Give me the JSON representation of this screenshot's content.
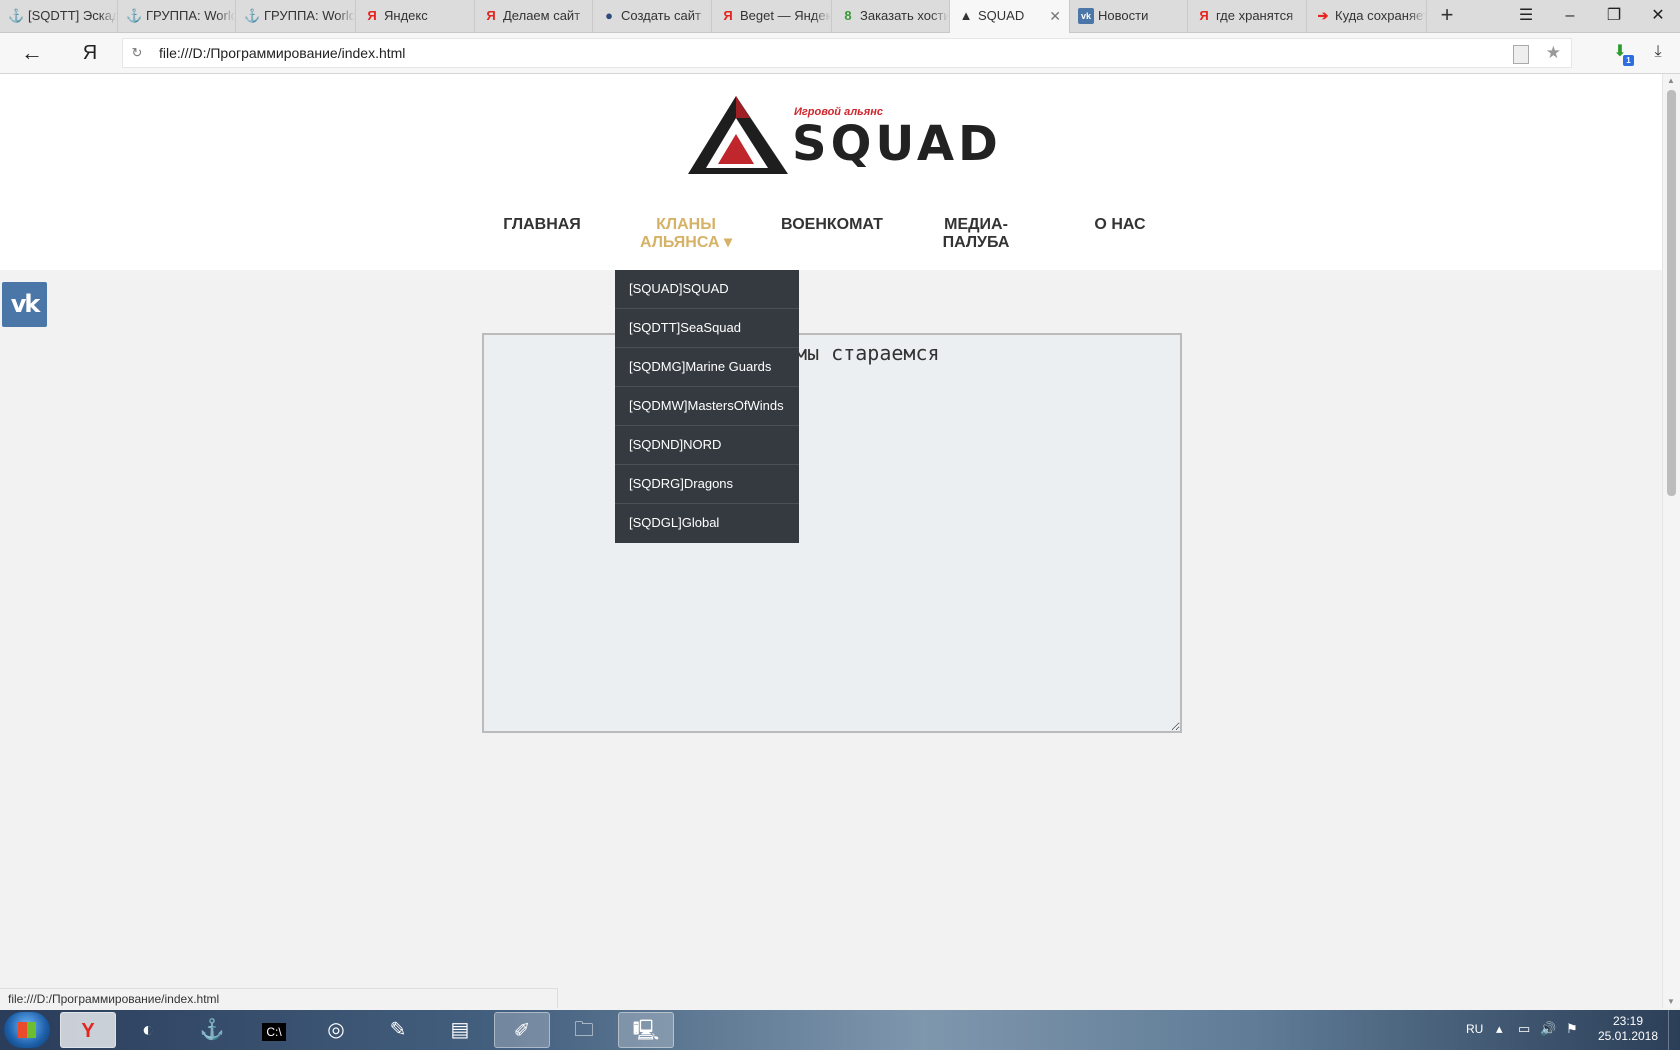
{
  "browser": {
    "tabs": [
      {
        "title": "[SQDTT] Эскадра",
        "icon": "wows-icon"
      },
      {
        "title": "ГРУППА: World",
        "icon": "wows-icon"
      },
      {
        "title": "ГРУППА: World",
        "icon": "wows-icon"
      },
      {
        "title": "Яндекс",
        "icon": "yandex-icon"
      },
      {
        "title": "Делаем сайт",
        "icon": "yandex-icon"
      },
      {
        "title": "Создать сайт",
        "icon": "globe-icon"
      },
      {
        "title": "Beget — Яндекс",
        "icon": "yandex-icon"
      },
      {
        "title": "Заказать хостинг",
        "icon": "b-icon"
      },
      {
        "title": "SQUAD",
        "icon": "squad-icon"
      },
      {
        "title": "Новости",
        "icon": "vk-icon"
      },
      {
        "title": "где хранятся",
        "icon": "yandex-icon"
      },
      {
        "title": "Куда сохраняет",
        "icon": "arrow-icon"
      }
    ],
    "active_tab": 8,
    "url": "file:///D:/Программирование/index.html",
    "status_url": "file:///D:/Программирование/index.html"
  },
  "site": {
    "logo": {
      "tagline": "Игровой альянс",
      "name": "SQUAD"
    },
    "nav": [
      {
        "label": "ГЛАВНАЯ"
      },
      {
        "label": "КЛАНЫ АЛЬЯНСА",
        "caret": "▾"
      },
      {
        "label": "ВОЕНКОМАТ"
      },
      {
        "label": "МЕДИА-ПАЛУБА"
      },
      {
        "label": "О НАС"
      }
    ],
    "dropdown": [
      "[SQUAD]SQUAD",
      "[SQDTT]SeaSquad",
      "[SQDMG]Marine Guards",
      "[SQDMW]MastersOfWinds",
      "[SQDND]NORD",
      "[SQDRG]Dragons",
      "[SQDGL]Global"
    ],
    "textarea_value": "                    есь, мы стараемся",
    "vk_label": "vk"
  },
  "taskbar": {
    "language": "RU",
    "time": "23:19",
    "date": "25.01.2018"
  }
}
